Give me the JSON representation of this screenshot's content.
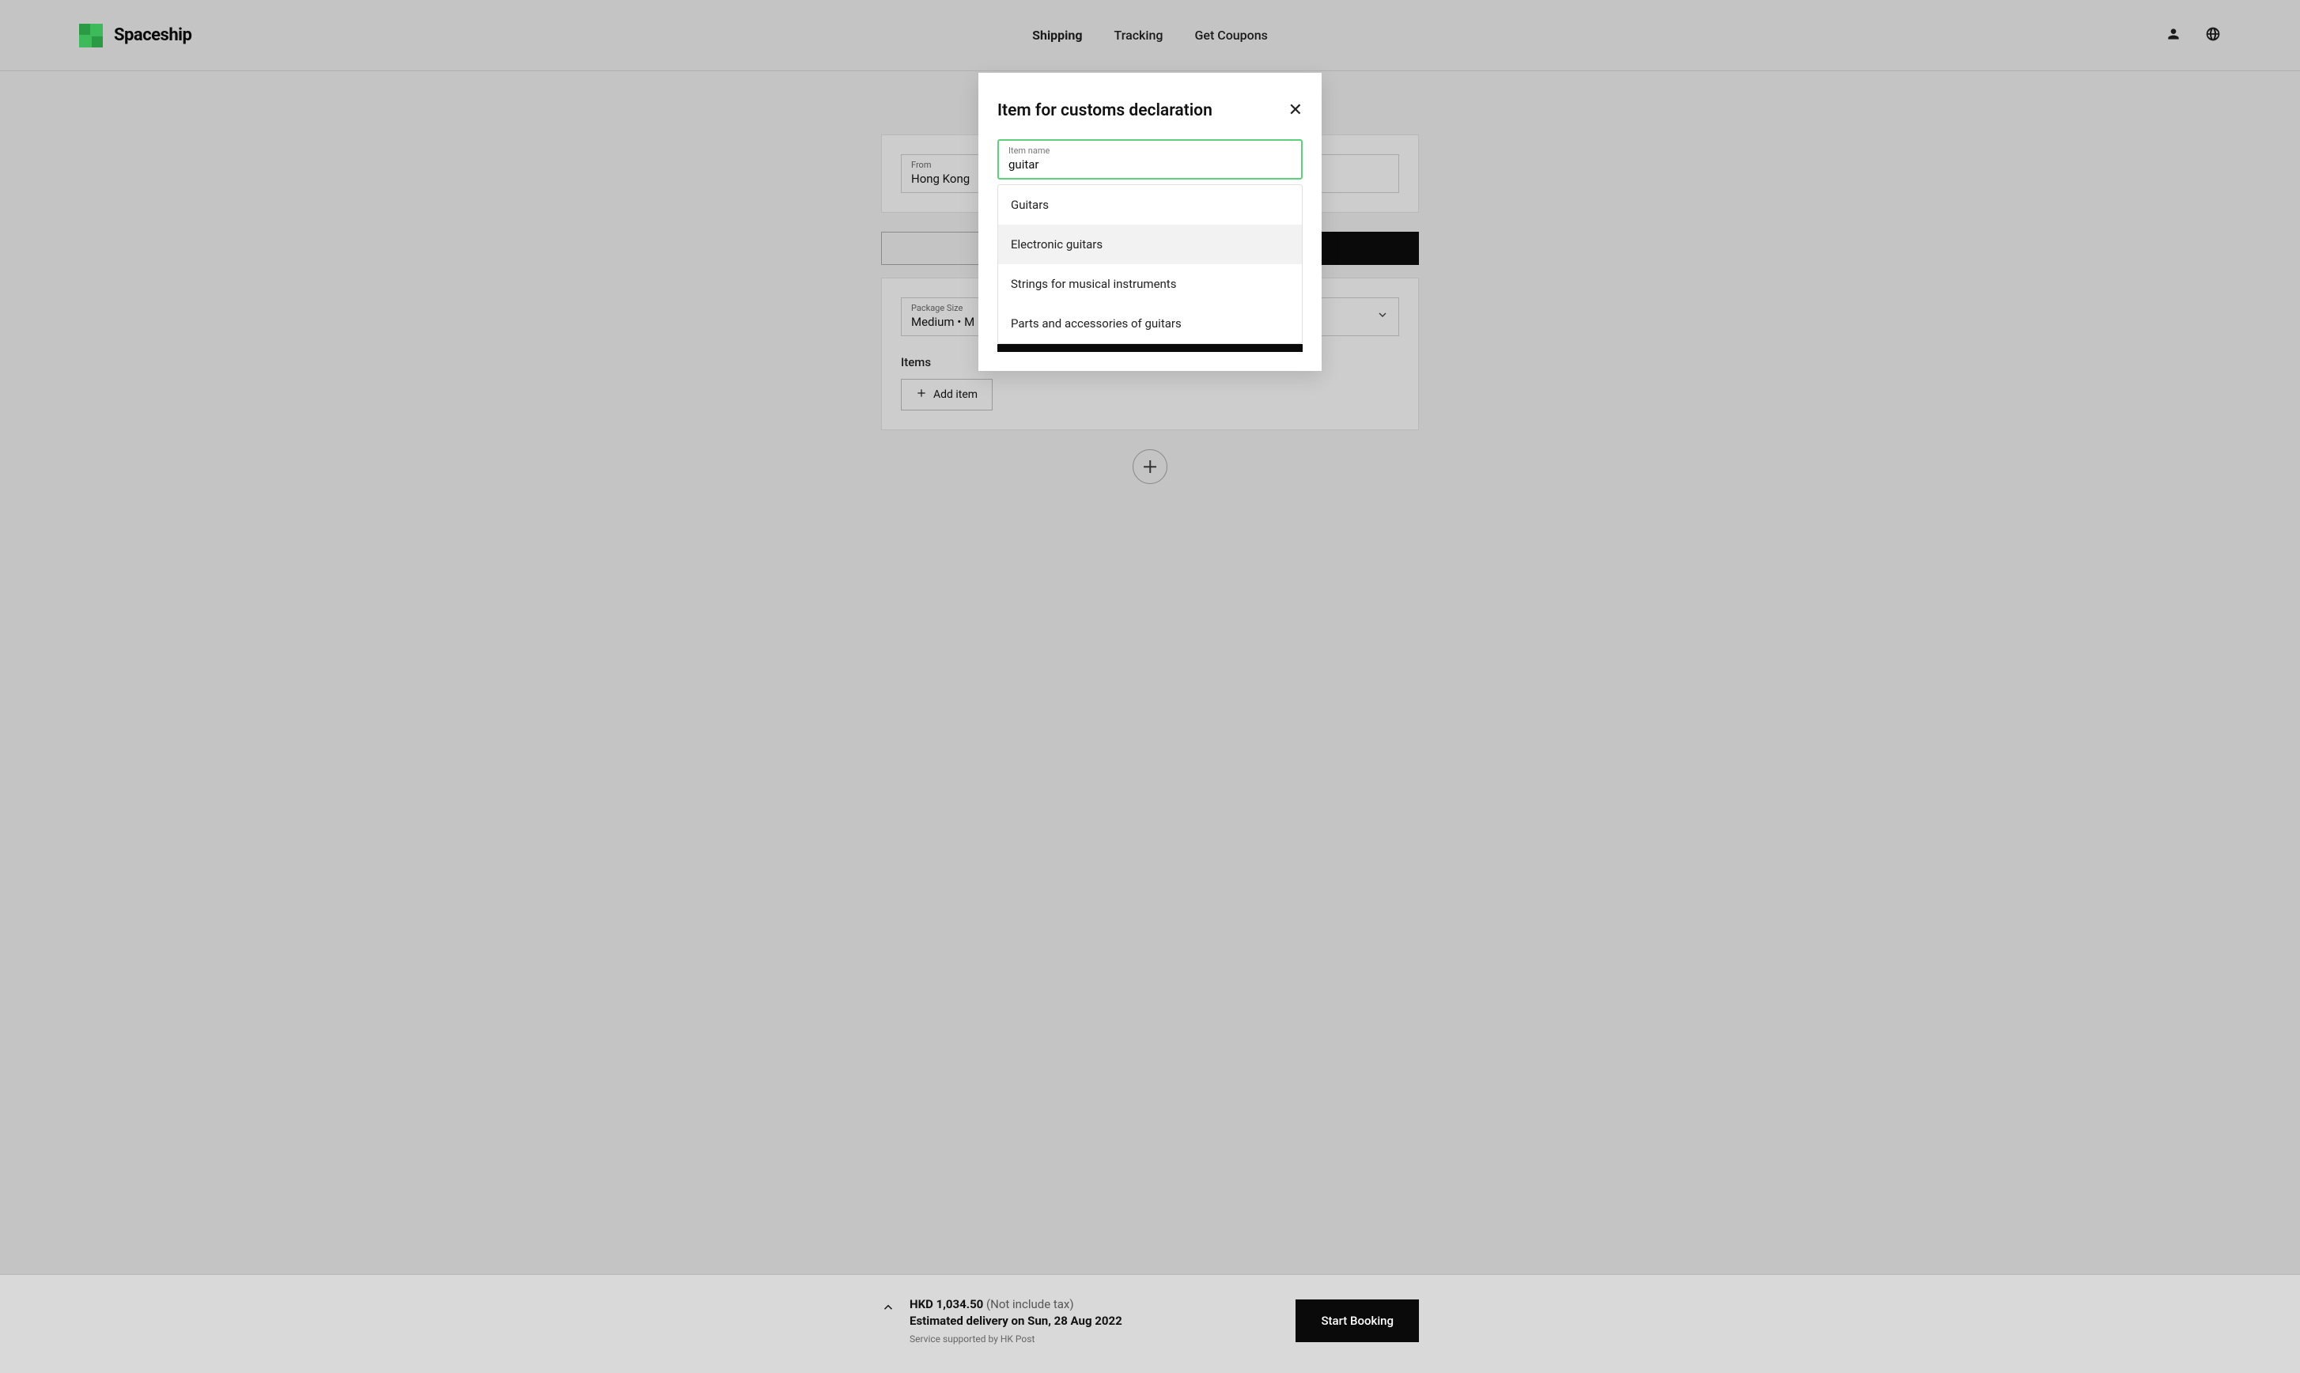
{
  "brand": "Spaceship",
  "nav": {
    "shipping": "Shipping",
    "tracking": "Tracking",
    "coupons": "Get Coupons"
  },
  "from": {
    "label": "From",
    "value": "Hong Kong"
  },
  "package": {
    "label": "Package Size",
    "value": "Medium • M"
  },
  "items_heading": "Items",
  "add_item_label": "Add item",
  "modal": {
    "title": "Item for customs declaration",
    "field_label": "Item name",
    "field_value": "guitar",
    "suggestions": [
      "Guitars",
      "Electronic guitars",
      "Strings for musical instruments",
      "Parts and accessories of guitars"
    ]
  },
  "footer": {
    "price": "HKD 1,034.50",
    "price_note": "(Not include tax)",
    "eta": "Estimated delivery on Sun, 28 Aug 2022",
    "support": "Service supported by HK Post",
    "start_label": "Start Booking"
  }
}
